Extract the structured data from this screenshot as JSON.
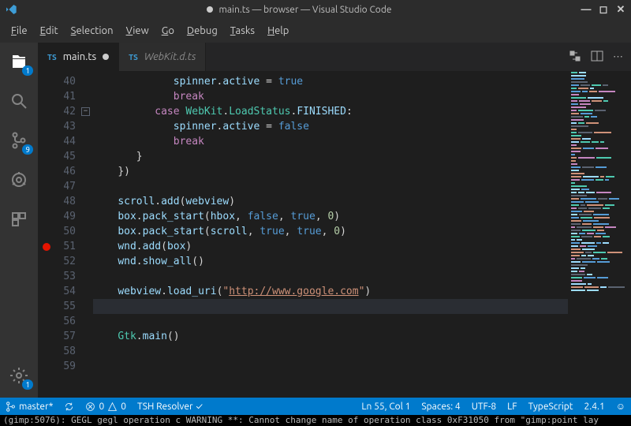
{
  "window": {
    "title": "main.ts — browser — Visual Studio Code",
    "dirty": true
  },
  "menu": [
    "File",
    "Edit",
    "Selection",
    "View",
    "Go",
    "Debug",
    "Tasks",
    "Help"
  ],
  "activity": {
    "explorer_badge": "1",
    "scm_badge": "9",
    "settings_badge": "1"
  },
  "tabs": [
    {
      "icon": "TS",
      "label": "main.ts",
      "dirty": true,
      "active": true
    },
    {
      "icon": "TS",
      "label": "WebKit.d.ts",
      "dirty": false,
      "active": false
    }
  ],
  "code_lines": [
    {
      "n": 40,
      "indent": 13,
      "tokens": [
        [
          "prop",
          "spinner"
        ],
        [
          "op",
          "."
        ],
        [
          "prop",
          "active"
        ],
        [
          "op",
          " = "
        ],
        [
          "lit",
          "true"
        ]
      ]
    },
    {
      "n": 41,
      "indent": 13,
      "tokens": [
        [
          "kw",
          "break"
        ]
      ]
    },
    {
      "n": 42,
      "indent": 10,
      "fold": true,
      "tokens": [
        [
          "kw",
          "case"
        ],
        [
          "op",
          " "
        ],
        [
          "cls",
          "WebKit"
        ],
        [
          "op",
          "."
        ],
        [
          "cls",
          "LoadStatus"
        ],
        [
          "op",
          "."
        ],
        [
          "prop",
          "FINISHED"
        ],
        [
          "op",
          ":"
        ]
      ]
    },
    {
      "n": 43,
      "indent": 13,
      "tokens": [
        [
          "prop",
          "spinner"
        ],
        [
          "op",
          "."
        ],
        [
          "prop",
          "active"
        ],
        [
          "op",
          " = "
        ],
        [
          "lit",
          "false"
        ]
      ]
    },
    {
      "n": 44,
      "indent": 13,
      "tokens": [
        [
          "kw",
          "break"
        ]
      ]
    },
    {
      "n": 45,
      "indent": 7,
      "tokens": [
        [
          "op",
          "}"
        ]
      ]
    },
    {
      "n": 46,
      "indent": 4,
      "tokens": [
        [
          "op",
          "})"
        ]
      ]
    },
    {
      "n": 47,
      "indent": 0,
      "tokens": []
    },
    {
      "n": 48,
      "indent": 4,
      "tokens": [
        [
          "prop",
          "scroll"
        ],
        [
          "op",
          "."
        ],
        [
          "prop",
          "add"
        ],
        [
          "op",
          "("
        ],
        [
          "prop",
          "webview"
        ],
        [
          "op",
          ")"
        ]
      ]
    },
    {
      "n": 49,
      "indent": 4,
      "tokens": [
        [
          "prop",
          "box"
        ],
        [
          "op",
          "."
        ],
        [
          "prop",
          "pack_start"
        ],
        [
          "op",
          "("
        ],
        [
          "prop",
          "hbox"
        ],
        [
          "op",
          ", "
        ],
        [
          "lit",
          "false"
        ],
        [
          "op",
          ", "
        ],
        [
          "lit",
          "true"
        ],
        [
          "op",
          ", "
        ],
        [
          "num",
          "0"
        ],
        [
          "op",
          ")"
        ]
      ]
    },
    {
      "n": 50,
      "indent": 4,
      "tokens": [
        [
          "prop",
          "box"
        ],
        [
          "op",
          "."
        ],
        [
          "prop",
          "pack_start"
        ],
        [
          "op",
          "("
        ],
        [
          "prop",
          "scroll"
        ],
        [
          "op",
          ", "
        ],
        [
          "lit",
          "true"
        ],
        [
          "op",
          ", "
        ],
        [
          "lit",
          "true"
        ],
        [
          "op",
          ", "
        ],
        [
          "num",
          "0"
        ],
        [
          "op",
          ")"
        ]
      ]
    },
    {
      "n": 51,
      "indent": 4,
      "bp": true,
      "tokens": [
        [
          "prop",
          "wnd"
        ],
        [
          "op",
          "."
        ],
        [
          "prop",
          "add"
        ],
        [
          "op",
          "("
        ],
        [
          "prop",
          "box"
        ],
        [
          "op",
          ")"
        ]
      ]
    },
    {
      "n": 52,
      "indent": 4,
      "tokens": [
        [
          "prop",
          "wnd"
        ],
        [
          "op",
          "."
        ],
        [
          "prop",
          "show_all"
        ],
        [
          "op",
          "()"
        ]
      ]
    },
    {
      "n": 53,
      "indent": 0,
      "tokens": []
    },
    {
      "n": 54,
      "indent": 4,
      "tokens": [
        [
          "prop",
          "webview"
        ],
        [
          "op",
          "."
        ],
        [
          "prop",
          "load_uri"
        ],
        [
          "op",
          "("
        ],
        [
          "str",
          "\""
        ],
        [
          "url",
          "http://www.google.com"
        ],
        [
          "str",
          "\""
        ],
        [
          "op",
          ")"
        ]
      ]
    },
    {
      "n": 55,
      "indent": 4,
      "cursor": true,
      "tokens": []
    },
    {
      "n": 56,
      "indent": 0,
      "tokens": []
    },
    {
      "n": 57,
      "indent": 4,
      "tokens": [
        [
          "cls",
          "Gtk"
        ],
        [
          "op",
          "."
        ],
        [
          "prop",
          "main"
        ],
        [
          "op",
          "()"
        ]
      ]
    },
    {
      "n": 58,
      "indent": 0,
      "tokens": []
    },
    {
      "n": 59,
      "indent": 0,
      "tokens": []
    }
  ],
  "status": {
    "branch": "master*",
    "errors": "0",
    "warnings": "0",
    "resolver": "TSH Resolver",
    "cursor": "Ln 55, Col 1",
    "spaces": "Spaces: 4",
    "encoding": "UTF-8",
    "eol": "LF",
    "lang": "TypeScript",
    "ts_version": "2.4.1"
  },
  "terminal_line": "(gimp:5076): GEGL gegl operation c WARNING **: Cannot change name of operation class 0xF31050 from \"gimp:point lay"
}
